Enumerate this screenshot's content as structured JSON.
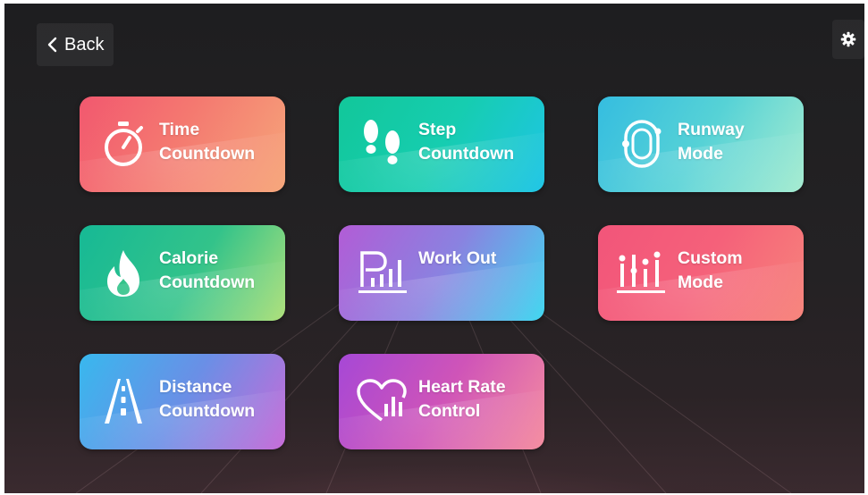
{
  "header": {
    "back_label": "Back"
  },
  "icons": {
    "back": "chevron-left-icon",
    "settings": "gear-icon"
  },
  "tiles": [
    {
      "id": "time-countdown",
      "line1": "Time",
      "line2": "Countdown",
      "icon": "stopwatch-icon",
      "color": "#f47870"
    },
    {
      "id": "step-countdown",
      "line1": "Step",
      "line2": "Countdown",
      "icon": "footprints-icon",
      "color": "#16cdb0"
    },
    {
      "id": "runway-mode",
      "line1": "Runway",
      "line2": "Mode",
      "icon": "track-icon",
      "color": "#56d2d6"
    },
    {
      "id": "calorie-countdown",
      "line1": "Calorie",
      "line2": "Countdown",
      "icon": "flame-icon",
      "color": "#33c38a"
    },
    {
      "id": "work-out",
      "line1": "Work Out",
      "line2": "",
      "icon": "bar-chart-icon",
      "color": "#8a82e0"
    },
    {
      "id": "custom-mode",
      "line1": "Custom",
      "line2": "Mode",
      "icon": "sliders-icon",
      "color": "#f5617a"
    },
    {
      "id": "distance-countdown",
      "line1": "Distance",
      "line2": "Countdown",
      "icon": "road-icon",
      "color": "#6a8fe6"
    },
    {
      "id": "heart-rate-control",
      "line1": "Heart Rate",
      "line2": "Control",
      "icon": "heart-chart-icon",
      "color": "#cf54b8"
    }
  ]
}
